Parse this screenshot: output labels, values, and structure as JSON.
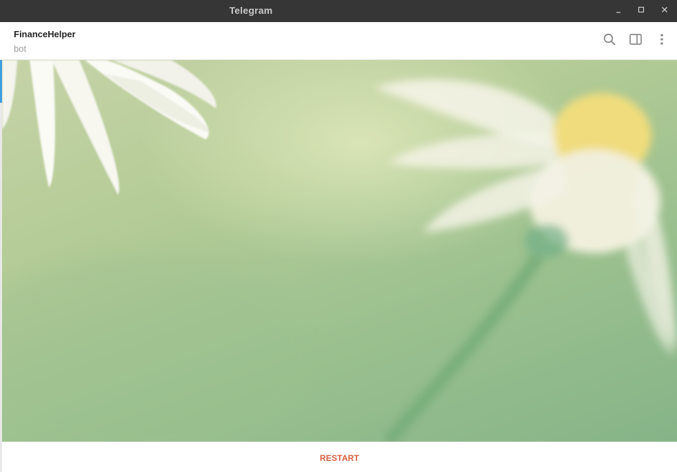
{
  "window": {
    "title": "Telegram",
    "controls": [
      "minimize-icon",
      "maximize-icon",
      "close-icon"
    ]
  },
  "chat": {
    "name": "FinanceHelper",
    "status": "bot"
  },
  "header_icons": [
    "search-icon",
    "sidebar-toggle-icon",
    "more-vertical-icon"
  ],
  "footer": {
    "restart_label": "RESTART"
  },
  "colors": {
    "titlebar": "#363636",
    "accent": "#3f9ee0",
    "restart": "#d95b3c"
  }
}
